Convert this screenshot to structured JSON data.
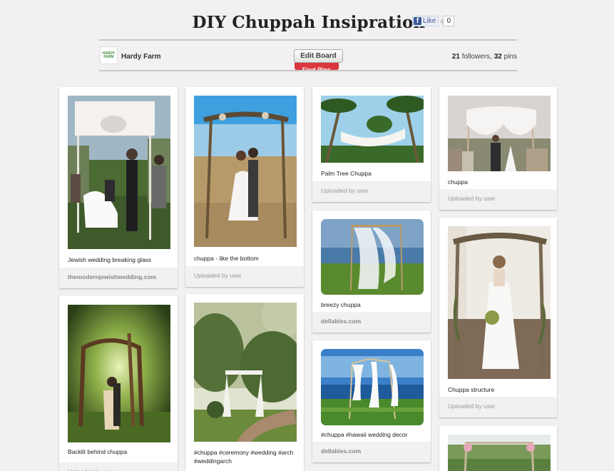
{
  "board": {
    "title": "DIY Chuppah Insipration",
    "like_label": "Like",
    "like_count": "0",
    "owner_name": "Hardy Farm",
    "owner_logo_text": "HARDY FARM",
    "edit_board_label": "Edit Board",
    "find_pins_label": "Find Pins",
    "followers": "21",
    "followers_label": "followers,",
    "pins": "32",
    "pins_label": "pins"
  },
  "pins": [
    {
      "description": "Jewish wedding breaking glass",
      "source": "themodernjewishwedding.com"
    },
    {
      "description": "chuppa - like the bottom",
      "source": "Uploaded by user"
    },
    {
      "description": "Palm Tree Chuppa",
      "source": "Uploaded by user"
    },
    {
      "description": "chuppa",
      "source": "Uploaded by user"
    },
    {
      "description": "breezy chuppa",
      "source": "dellables.com"
    },
    {
      "description": "Chuppa structure",
      "source": "Uploaded by user"
    },
    {
      "description": "#chuppa #hawaii wedding decor",
      "source": "dellables.com"
    },
    {
      "description": "Backlit behind chuppa",
      "source": "Uploaded by user"
    },
    {
      "description": "#chuppa #ceremony #wedding #arch #weddingarch",
      "source": ""
    },
    {
      "description": "",
      "source": ""
    }
  ]
}
